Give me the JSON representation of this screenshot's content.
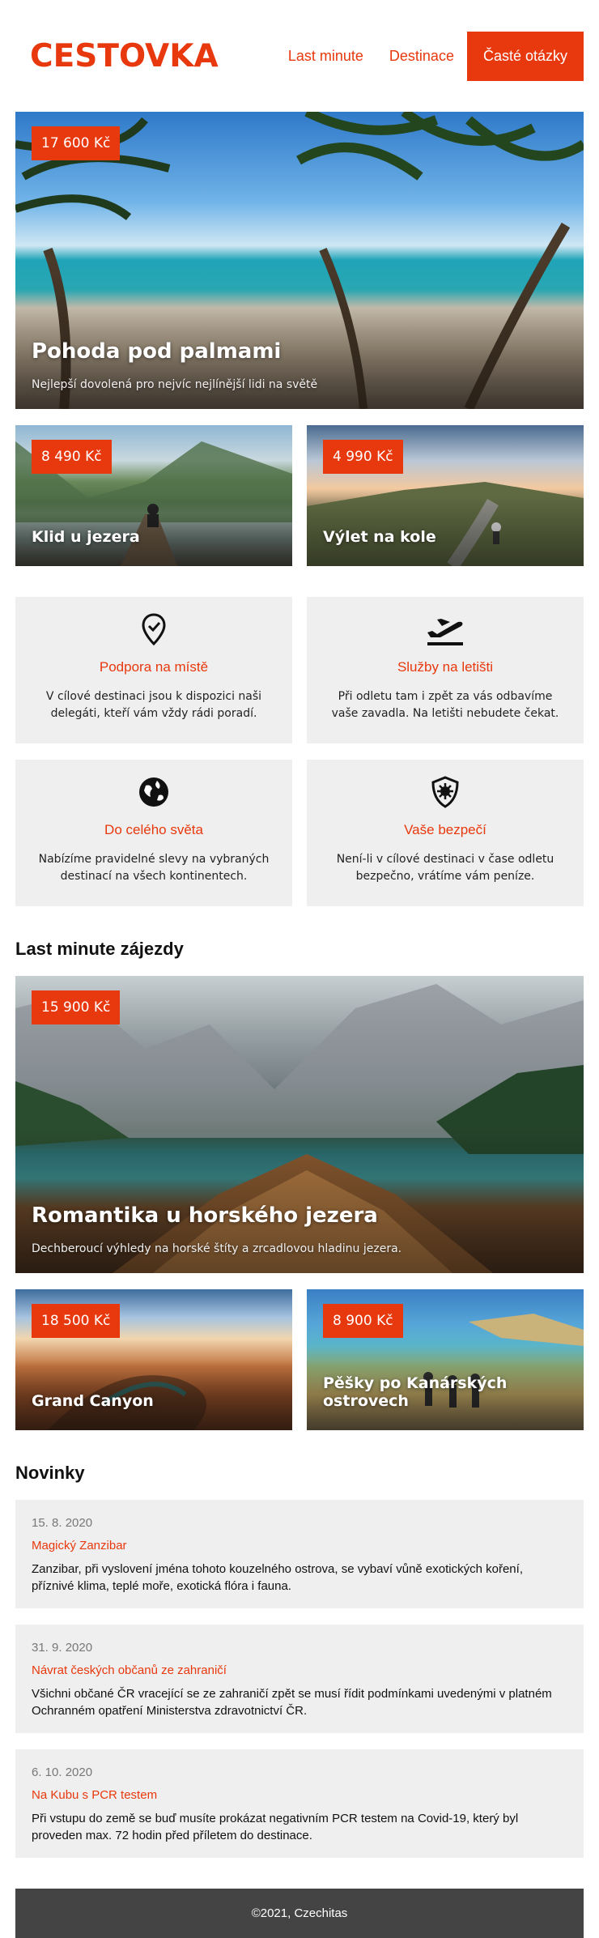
{
  "brand": {
    "logo": "CESTOVKA",
    "accent": "#e8380d"
  },
  "nav": {
    "items": [
      {
        "label": "Last minute"
      },
      {
        "label": "Destinace"
      },
      {
        "label": "Časté otázky"
      }
    ]
  },
  "hero": {
    "price": "17 600 Kč",
    "title": "Pohoda pod palmami",
    "subtitle": "Nejlepší dovolená pro nejvíc nejlínější lidi na světě"
  },
  "top_cards": [
    {
      "price": "8 490 Kč",
      "title": "Klid u jezera"
    },
    {
      "price": "4 990 Kč",
      "title": "Výlet na kole"
    }
  ],
  "features": [
    {
      "icon": "location-pin-icon",
      "title": "Podpora na místě",
      "text": "V cílové destinaci jsou k dispozici naši delegáti, kteří vám vždy rádi poradí."
    },
    {
      "icon": "airplane-departure-icon",
      "title": "Služby na letišti",
      "text": "Při odletu tam i zpět za vás odbavíme vaše zavadla. Na letišti nebudete čekat."
    },
    {
      "icon": "globe-icon",
      "title": "Do celého světa",
      "text": "Nabízíme pravidelné slevy na vybraných destinací na všech kontinentech."
    },
    {
      "icon": "shield-virus-icon",
      "title": "Vaše bezpečí",
      "text": "Není-li v cílové destinaci v čase odletu bezpečno, vrátíme vám peníze."
    }
  ],
  "last_minute": {
    "heading": "Last minute zájezdy",
    "main": {
      "price": "15 900 Kč",
      "title": "Romantika u horského jezera",
      "subtitle": "Dechberoucí výhledy na horské štíty a zrcadlovou hladinu jezera."
    },
    "cards": [
      {
        "price": "18 500 Kč",
        "title": "Grand Canyon"
      },
      {
        "price": "8 900 Kč",
        "title": "Pěšky po Kanárských ostrovech"
      }
    ]
  },
  "news": {
    "heading": "Novinky",
    "items": [
      {
        "date": "15. 8. 2020",
        "title": "Magický Zanzibar",
        "text": "Zanzibar, při vyslovení jména tohoto kouzelného ostrova, se vybaví vůně exotických koření, příznivé klima, teplé moře, exotická flóra i fauna."
      },
      {
        "date": "31. 9. 2020",
        "title": "Návrat českých občanů ze zahraničí",
        "text": "Všichni občané ČR vracející se ze zahraničí zpět se musí řídit podmínkami uvedenými v platném Ochranném opatření Ministerstva zdravotnictví ČR."
      },
      {
        "date": "6. 10. 2020",
        "title": "Na Kubu s PCR testem",
        "text": "Při vstupu do země se buď musíte prokázat negativním PCR testem na Covid-19, který byl proveden max. 72 hodin před příletem do destinace."
      }
    ]
  },
  "footer": {
    "text": "©2021, Czechitas"
  }
}
